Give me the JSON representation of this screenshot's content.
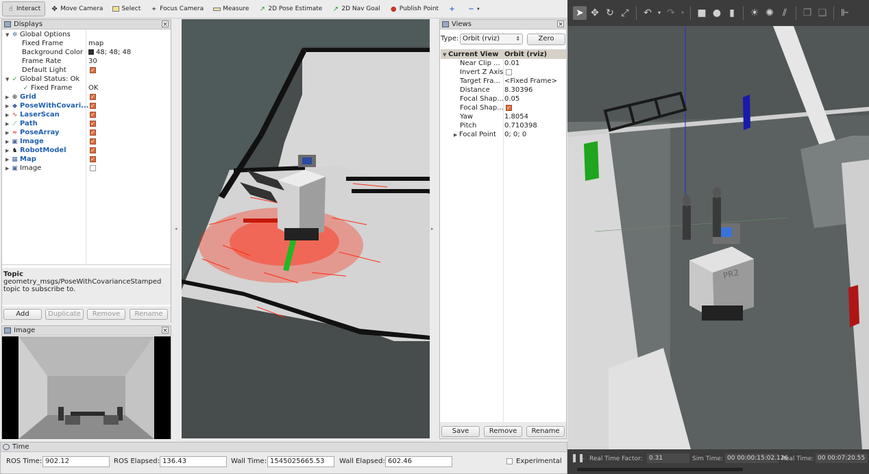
{
  "toolbar": {
    "items": [
      {
        "label": "Interact",
        "icon": "hand-icon"
      },
      {
        "label": "Move Camera",
        "icon": "move-camera-icon"
      },
      {
        "label": "Select",
        "icon": "select-icon"
      },
      {
        "label": "Focus Camera",
        "icon": "focus-camera-icon"
      },
      {
        "label": "Measure",
        "icon": "ruler-icon"
      },
      {
        "label": "2D Pose Estimate",
        "icon": "pose-estimate-icon"
      },
      {
        "label": "2D Nav Goal",
        "icon": "nav-goal-icon"
      },
      {
        "label": "Publish Point",
        "icon": "map-pin-icon"
      }
    ]
  },
  "displays": {
    "title": "Displays",
    "global_options": "Global Options",
    "fixed_frame_label": "Fixed Frame",
    "fixed_frame_value": "map",
    "background_color_label": "Background Color",
    "background_color_value": "48; 48; 48",
    "frame_rate_label": "Frame Rate",
    "frame_rate_value": "30",
    "default_light_label": "Default Light",
    "global_status_label": "Global Status: Ok",
    "status_fixed_frame_label": "Fixed Frame",
    "status_fixed_frame_value": "OK",
    "items": [
      {
        "name": "Grid",
        "checked": true
      },
      {
        "name": "PoseWithCovari...",
        "checked": true
      },
      {
        "name": "LaserScan",
        "checked": true
      },
      {
        "name": "Path",
        "checked": true
      },
      {
        "name": "PoseArray",
        "checked": true
      },
      {
        "name": "Image",
        "checked": true
      },
      {
        "name": "RobotModel",
        "checked": true
      },
      {
        "name": "Map",
        "checked": true
      },
      {
        "name": "Image",
        "checked": false
      }
    ],
    "topic_heading": "Topic",
    "topic_line1": "geometry_msgs/PoseWithCovarianceStamped",
    "topic_line2": "topic to subscribe to.",
    "buttons": {
      "add": "Add",
      "duplicate": "Duplicate",
      "remove": "Remove",
      "rename": "Rename"
    }
  },
  "image_panel": {
    "title": "Image"
  },
  "views": {
    "title": "Views",
    "type_label": "Type:",
    "type_value": "Orbit (rviz)",
    "zero_label": "Zero",
    "current_view_label": "Current View",
    "current_view_value": "Orbit (rviz)",
    "props": [
      {
        "name": "Near Clip ...",
        "value": "0.01"
      },
      {
        "name": "Invert Z Axis",
        "value": ""
      },
      {
        "name": "Target Fra...",
        "value": "<Fixed Frame>"
      },
      {
        "name": "Distance",
        "value": "8.30396"
      },
      {
        "name": "Focal Shap...",
        "value": "0.05"
      },
      {
        "name": "Focal Shap...",
        "value": ""
      },
      {
        "name": "Yaw",
        "value": "1.8054"
      },
      {
        "name": "Pitch",
        "value": "0.710398"
      },
      {
        "name": "Focal Point",
        "value": "0; 0; 0"
      }
    ],
    "buttons": {
      "save": "Save",
      "remove": "Remove",
      "rename": "Rename"
    }
  },
  "time": {
    "title": "Time",
    "ros_time_label": "ROS Time:",
    "ros_time_value": "902.12",
    "ros_elapsed_label": "ROS Elapsed:",
    "ros_elapsed_value": "136.43",
    "wall_time_label": "Wall Time:",
    "wall_time_value": "1545025665.53",
    "wall_elapsed_label": "Wall Elapsed:",
    "wall_elapsed_value": "602.46",
    "experimental_label": "Experimental"
  },
  "gazebo": {
    "real_time_factor_label": "Real Time Factor:",
    "real_time_factor_value": "0.31",
    "sim_time_label": "Sim Time:",
    "sim_time_value": "00 00:00:15:02.126",
    "real_time_label": "Real Time:",
    "real_time_value": "00 00:07:20.55",
    "robot_label": "PR2"
  },
  "colors": {
    "rviz_bg": "#ebebeb",
    "viewport_bg": "#4f5b5b",
    "laser": "#ff2a12",
    "gazebo_bg": "#59605f",
    "accent_checkbox": "#d86a3a"
  }
}
